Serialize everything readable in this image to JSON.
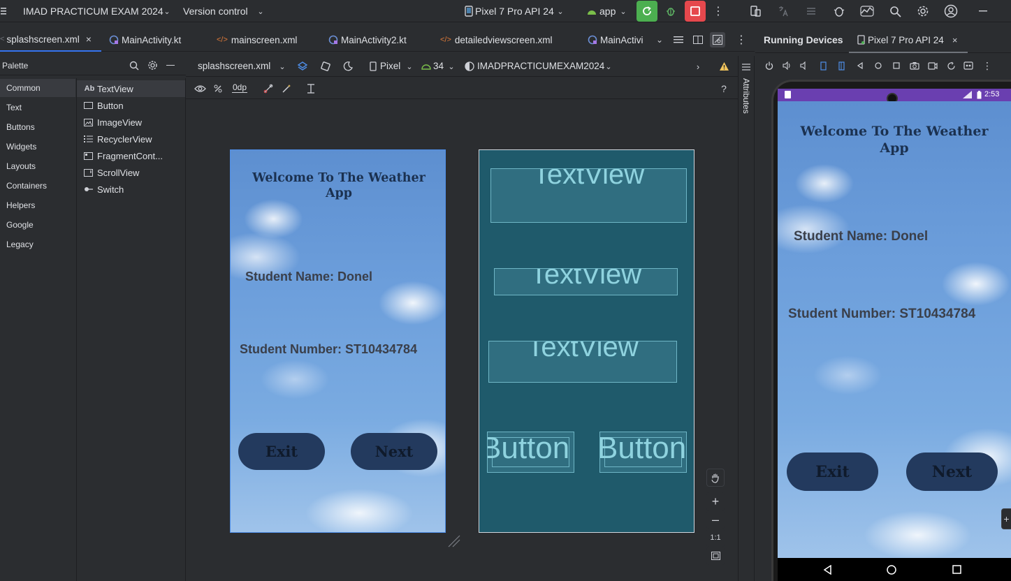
{
  "titlebar": {
    "project": "IMAD PRACTICUM EXAM 2024",
    "vcs": "Version control",
    "device": "Pixel 7 Pro API 24",
    "run_config": "app"
  },
  "editor_tabs": [
    {
      "label": "splashscreen.xml",
      "icon": "xml-icon",
      "active": true
    },
    {
      "label": "MainActivity.kt",
      "icon": "kotlin-activity-icon"
    },
    {
      "label": "mainscreen.xml",
      "icon": "xml-icon"
    },
    {
      "label": "MainActivity2.kt",
      "icon": "kotlin-icon"
    },
    {
      "label": "detailedviewscreen.xml",
      "icon": "xml-icon"
    },
    {
      "label": "MainActivi",
      "icon": "kotlin-activity-icon"
    }
  ],
  "palette": {
    "title": "Palette",
    "categories": [
      "Common",
      "Text",
      "Buttons",
      "Widgets",
      "Layouts",
      "Containers",
      "Helpers",
      "Google",
      "Legacy"
    ],
    "selected_category": "Common",
    "items": [
      {
        "label": "TextView",
        "icon": "Ab"
      },
      {
        "label": "Button",
        "icon": "button-icon"
      },
      {
        "label": "ImageView",
        "icon": "image-icon"
      },
      {
        "label": "RecyclerView",
        "icon": "list-icon"
      },
      {
        "label": "FragmentCont...",
        "icon": "fragment-icon"
      },
      {
        "label": "ScrollView",
        "icon": "scroll-icon"
      },
      {
        "label": "Switch",
        "icon": "switch-icon"
      }
    ]
  },
  "design_toolbar": {
    "file": "splashscreen.xml",
    "device": "Pixel",
    "api": "34",
    "theme": "IMADPRACTICUMEXAM2024",
    "margin": "0dp"
  },
  "layout": {
    "welcome": "Welcome To The Weather App",
    "student_name": "Student Name: Donel",
    "student_number": "Student Number: ST10434784",
    "exit_button": "Exit",
    "next_button": "Next"
  },
  "blueprint": {
    "textview": "TextView",
    "button": "Button"
  },
  "zoom": {
    "one_to_one": "1:1"
  },
  "attributes_label": "Attributes",
  "running_devices": {
    "title": "Running Devices",
    "device_tab": "Pixel 7 Pro API 24",
    "status_time": "2:53"
  },
  "colors": {
    "accent": "#3574f0",
    "run_green": "#4caf50",
    "stop_red": "#e5484d",
    "app_button": "#233a5e",
    "blueprint_bg": "#1f5a6b"
  }
}
